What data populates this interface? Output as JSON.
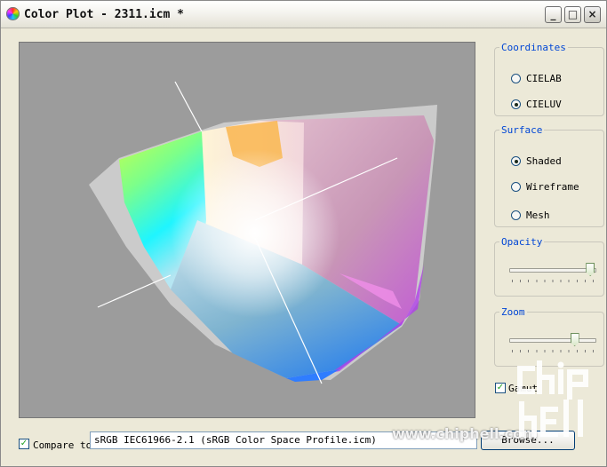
{
  "window": {
    "title": "Color Plot - 2311.icm *",
    "minimize_glyph": "_",
    "maximize_glyph": "□",
    "close_glyph": "×"
  },
  "coordinates": {
    "legend": "Coordinates",
    "options": [
      "CIELAB",
      "CIELUV"
    ],
    "selected": "CIELUV"
  },
  "surface": {
    "legend": "Surface",
    "options": [
      "Shaded",
      "Wireframe",
      "Mesh"
    ],
    "selected": "Shaded"
  },
  "opacity": {
    "legend": "Opacity",
    "value_fraction": 0.98
  },
  "zoom": {
    "legend": "Zoom",
    "value_fraction": 0.78
  },
  "gamut": {
    "label": "Gamut",
    "checked": true
  },
  "compare": {
    "label": "Compare to:",
    "checked": true,
    "value": "sRGB IEC61966-2.1 (sRGB Color Space Profile.icm)",
    "button_label": "Browse..."
  },
  "watermark": {
    "url": "www.chiphell.com",
    "logo_text": "chip hell"
  },
  "icons": {
    "app": "color-wheel-icon",
    "check": "checkmark-icon"
  },
  "colors": {
    "legend_text": "#0046d5",
    "plot_background": "#9c9c9c",
    "window_background": "#ece9d8"
  }
}
